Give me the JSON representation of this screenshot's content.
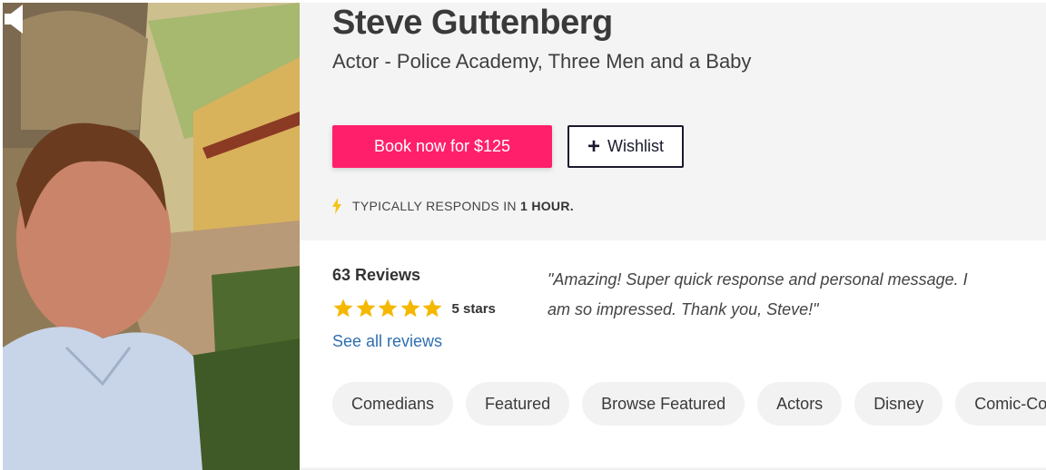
{
  "profile": {
    "name": "Steve Guttenberg",
    "tagline": "Actor - Police Academy, Three Men and a Baby"
  },
  "actions": {
    "book_label": "Book now for $125",
    "wishlist_label": "Wishlist"
  },
  "response": {
    "prefix": "TYPICALLY RESPONDS IN",
    "time": "1 HOUR."
  },
  "reviews": {
    "count_label": "63 Reviews",
    "rating": 5,
    "stars_label": "5 stars",
    "see_all_label": "See all reviews",
    "featured_quote": "\"Amazing! Super quick response and personal message. I am so impressed. Thank you, Steve!\""
  },
  "categories": [
    "Comedians",
    "Featured",
    "Browse Featured",
    "Actors",
    "Disney",
    "Comic-Con"
  ],
  "colors": {
    "accent": "#ff1f6b",
    "star": "#f5b800",
    "link": "#2f6fb0",
    "bolt": "#f5c518"
  },
  "icons": {
    "mute": "speaker-icon",
    "bolt": "lightning-bolt-icon",
    "plus": "plus-icon",
    "star": "star-icon"
  }
}
